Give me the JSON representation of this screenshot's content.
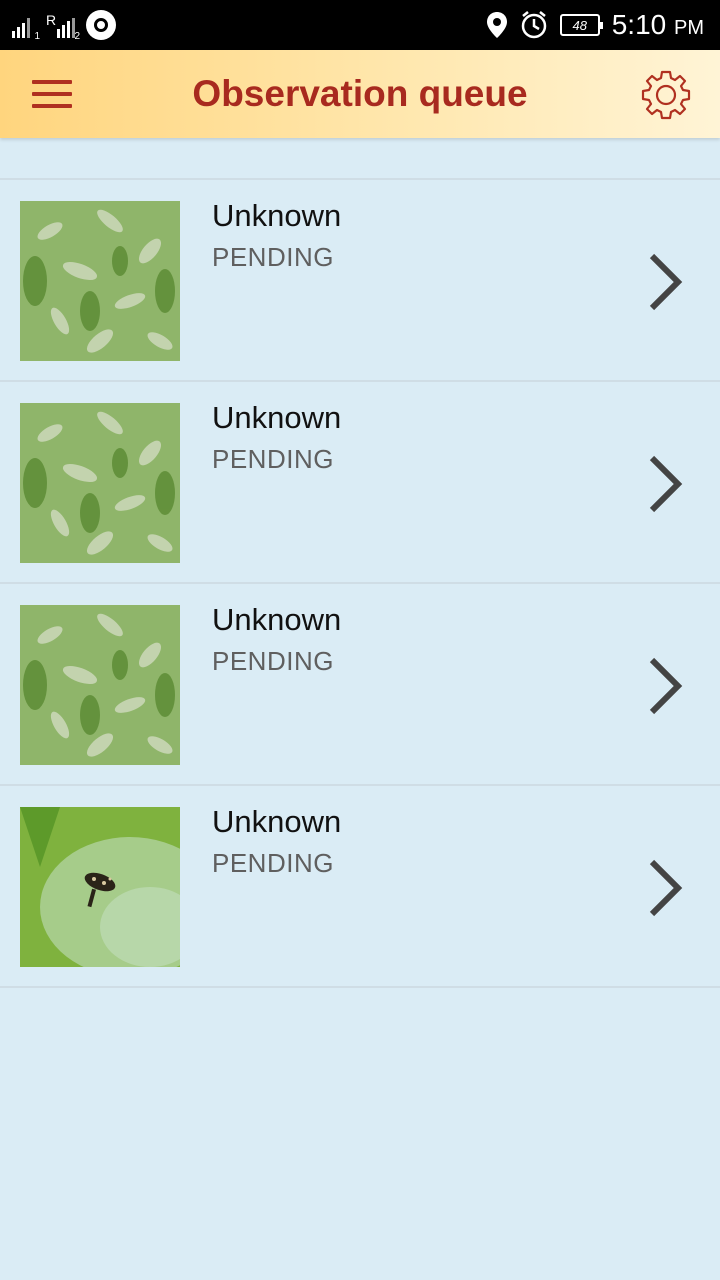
{
  "status_bar": {
    "sim1_sub": "1",
    "sim2_prefix": "R",
    "sim2_sub": "2",
    "battery": "48",
    "time": "5:10",
    "ampm": "PM",
    "icons": [
      "signal-icon",
      "roaming-signal-icon",
      "app-notification-icon",
      "location-icon",
      "alarm-icon",
      "battery-icon"
    ]
  },
  "app_bar": {
    "title": "Observation queue",
    "menu_icon": "hamburger-menu-icon",
    "settings_icon": "gear-icon",
    "accent": "#a82a1f"
  },
  "observations": [
    {
      "name": "Unknown",
      "status": "PENDING",
      "thumbnail": "plant-photo"
    },
    {
      "name": "Unknown",
      "status": "PENDING",
      "thumbnail": "plant-photo"
    },
    {
      "name": "Unknown",
      "status": "PENDING",
      "thumbnail": "plant-photo"
    },
    {
      "name": "Unknown",
      "status": "PENDING",
      "thumbnail": "leaf-insect-photo"
    }
  ],
  "colors": {
    "background": "#daecf5",
    "status_text": "#5f5f5f"
  }
}
